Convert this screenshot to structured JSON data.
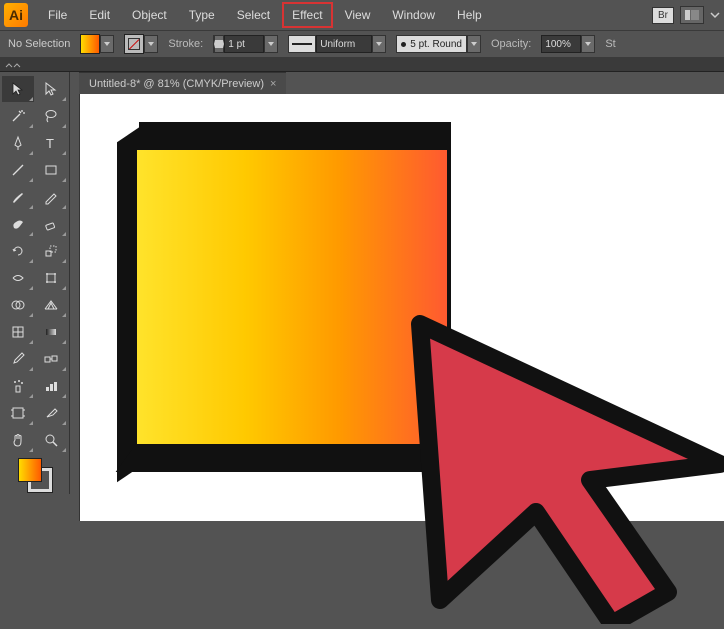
{
  "app": {
    "logo": "Ai"
  },
  "menu": {
    "file": "File",
    "edit": "Edit",
    "object": "Object",
    "type": "Type",
    "select": "Select",
    "effect": "Effect",
    "view": "View",
    "window": "Window",
    "help": "Help",
    "br": "Br"
  },
  "options": {
    "no_selection": "No Selection",
    "stroke_label": "Stroke:",
    "stroke_weight": "1 pt",
    "stroke_style": "Uniform",
    "brush_profile": "5 pt. Round",
    "opacity_label": "Opacity:",
    "opacity_value": "100%",
    "style_label": "St"
  },
  "document": {
    "tab_title": "Untitled-8* @ 81% (CMYK/Preview)",
    "close": "×"
  },
  "tools": {
    "items": [
      "selection",
      "direct-selection",
      "magic-wand",
      "lasso",
      "pen",
      "type",
      "line",
      "rectangle",
      "paintbrush",
      "pencil",
      "blob-brush",
      "eraser",
      "rotate",
      "scale",
      "width",
      "free-transform",
      "shape-builder",
      "perspective-grid",
      "mesh",
      "gradient",
      "eyedropper",
      "blend",
      "symbol-sprayer",
      "column-graph",
      "artboard",
      "slice",
      "hand",
      "zoom"
    ]
  },
  "colors": {
    "accent_start": "#ffdc00",
    "accent_end": "#ff5a00",
    "highlight_border": "#d83333",
    "cursor_fill": "#d63a4a",
    "cursor_stroke": "#111111"
  }
}
